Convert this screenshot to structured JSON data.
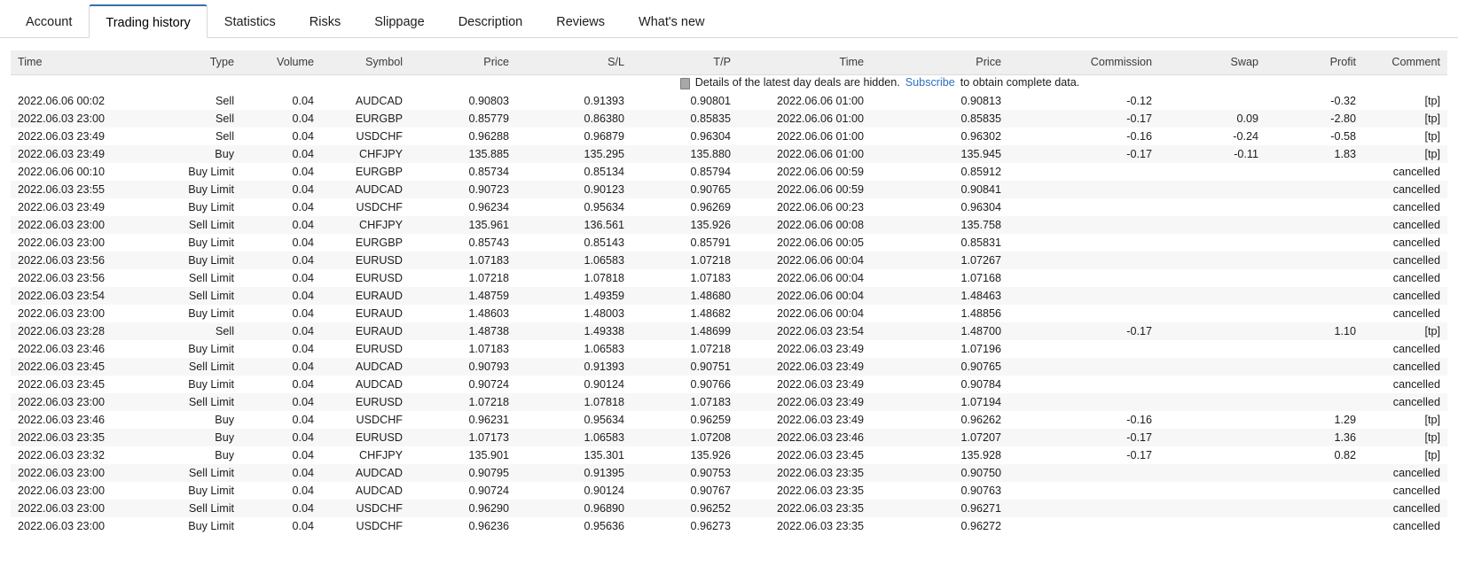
{
  "tabs": [
    {
      "label": "Account",
      "active": false
    },
    {
      "label": "Trading history",
      "active": true
    },
    {
      "label": "Statistics",
      "active": false
    },
    {
      "label": "Risks",
      "active": false
    },
    {
      "label": "Slippage",
      "active": false
    },
    {
      "label": "Description",
      "active": false
    },
    {
      "label": "Reviews",
      "active": false
    },
    {
      "label": "What's new",
      "active": false
    }
  ],
  "table": {
    "headers": [
      {
        "label": "Time",
        "align": "left"
      },
      {
        "label": "Type",
        "align": "right"
      },
      {
        "label": "Volume",
        "align": "right"
      },
      {
        "label": "Symbol",
        "align": "right"
      },
      {
        "label": "Price",
        "align": "right"
      },
      {
        "label": "S/L",
        "align": "right"
      },
      {
        "label": "T/P",
        "align": "right"
      },
      {
        "label": "Time",
        "align": "right"
      },
      {
        "label": "Price",
        "align": "right"
      },
      {
        "label": "Commission",
        "align": "right"
      },
      {
        "label": "Swap",
        "align": "right"
      },
      {
        "label": "Profit",
        "align": "right"
      },
      {
        "label": "Comment",
        "align": "right"
      }
    ],
    "notice": {
      "icon": "info-icon",
      "text_before": "Details of the latest day deals are hidden.",
      "link_label": "Subscribe",
      "text_after": "to obtain complete data."
    },
    "rows": [
      {
        "time_open": "2022.06.06 00:02",
        "type": "Sell",
        "volume": "0.04",
        "symbol": "AUDCAD",
        "price_open": "0.90803",
        "sl": "0.91393",
        "tp": "0.90801",
        "time_close": "2022.06.06 01:00",
        "price_close": "0.90813",
        "commission": "-0.12",
        "swap": "",
        "profit": "-0.32",
        "comment": "[tp]"
      },
      {
        "time_open": "2022.06.03 23:00",
        "type": "Sell",
        "volume": "0.04",
        "symbol": "EURGBP",
        "price_open": "0.85779",
        "sl": "0.86380",
        "tp": "0.85835",
        "time_close": "2022.06.06 01:00",
        "price_close": "0.85835",
        "commission": "-0.17",
        "swap": "0.09",
        "profit": "-2.80",
        "comment": "[tp]"
      },
      {
        "time_open": "2022.06.03 23:49",
        "type": "Sell",
        "volume": "0.04",
        "symbol": "USDCHF",
        "price_open": "0.96288",
        "sl": "0.96879",
        "tp": "0.96304",
        "time_close": "2022.06.06 01:00",
        "price_close": "0.96302",
        "commission": "-0.16",
        "swap": "-0.24",
        "profit": "-0.58",
        "comment": "[tp]"
      },
      {
        "time_open": "2022.06.03 23:49",
        "type": "Buy",
        "volume": "0.04",
        "symbol": "CHFJPY",
        "price_open": "135.885",
        "sl": "135.295",
        "tp": "135.880",
        "time_close": "2022.06.06 01:00",
        "price_close": "135.945",
        "commission": "-0.17",
        "swap": "-0.11",
        "profit": "1.83",
        "comment": "[tp]"
      },
      {
        "time_open": "2022.06.06 00:10",
        "type": "Buy Limit",
        "volume": "0.04",
        "symbol": "EURGBP",
        "price_open": "0.85734",
        "sl": "0.85134",
        "tp": "0.85794",
        "time_close": "2022.06.06 00:59",
        "price_close": "0.85912",
        "commission": "",
        "swap": "",
        "profit": "",
        "comment": "cancelled"
      },
      {
        "time_open": "2022.06.03 23:55",
        "type": "Buy Limit",
        "volume": "0.04",
        "symbol": "AUDCAD",
        "price_open": "0.90723",
        "sl": "0.90123",
        "tp": "0.90765",
        "time_close": "2022.06.06 00:59",
        "price_close": "0.90841",
        "commission": "",
        "swap": "",
        "profit": "",
        "comment": "cancelled"
      },
      {
        "time_open": "2022.06.03 23:49",
        "type": "Buy Limit",
        "volume": "0.04",
        "symbol": "USDCHF",
        "price_open": "0.96234",
        "sl": "0.95634",
        "tp": "0.96269",
        "time_close": "2022.06.06 00:23",
        "price_close": "0.96304",
        "commission": "",
        "swap": "",
        "profit": "",
        "comment": "cancelled"
      },
      {
        "time_open": "2022.06.03 23:00",
        "type": "Sell Limit",
        "volume": "0.04",
        "symbol": "CHFJPY",
        "price_open": "135.961",
        "sl": "136.561",
        "tp": "135.926",
        "time_close": "2022.06.06 00:08",
        "price_close": "135.758",
        "commission": "",
        "swap": "",
        "profit": "",
        "comment": "cancelled",
        "caret": true
      },
      {
        "time_open": "2022.06.03 23:00",
        "type": "Buy Limit",
        "volume": "0.04",
        "symbol": "EURGBP",
        "price_open": "0.85743",
        "sl": "0.85143",
        "tp": "0.85791",
        "time_close": "2022.06.06 00:05",
        "price_close": "0.85831",
        "commission": "",
        "swap": "",
        "profit": "",
        "comment": "cancelled"
      },
      {
        "time_open": "2022.06.03 23:56",
        "type": "Buy Limit",
        "volume": "0.04",
        "symbol": "EURUSD",
        "price_open": "1.07183",
        "sl": "1.06583",
        "tp": "1.07218",
        "time_close": "2022.06.06 00:04",
        "price_close": "1.07267",
        "commission": "",
        "swap": "",
        "profit": "",
        "comment": "cancelled"
      },
      {
        "time_open": "2022.06.03 23:56",
        "type": "Sell Limit",
        "volume": "0.04",
        "symbol": "EURUSD",
        "price_open": "1.07218",
        "sl": "1.07818",
        "tp": "1.07183",
        "time_close": "2022.06.06 00:04",
        "price_close": "1.07168",
        "commission": "",
        "swap": "",
        "profit": "",
        "comment": "cancelled"
      },
      {
        "time_open": "2022.06.03 23:54",
        "type": "Sell Limit",
        "volume": "0.04",
        "symbol": "EURAUD",
        "price_open": "1.48759",
        "sl": "1.49359",
        "tp": "1.48680",
        "time_close": "2022.06.06 00:04",
        "price_close": "1.48463",
        "commission": "",
        "swap": "",
        "profit": "",
        "comment": "cancelled"
      },
      {
        "time_open": "2022.06.03 23:00",
        "type": "Buy Limit",
        "volume": "0.04",
        "symbol": "EURAUD",
        "price_open": "1.48603",
        "sl": "1.48003",
        "tp": "1.48682",
        "time_close": "2022.06.06 00:04",
        "price_close": "1.48856",
        "commission": "",
        "swap": "",
        "profit": "",
        "comment": "cancelled"
      },
      {
        "time_open": "2022.06.03 23:28",
        "type": "Sell",
        "volume": "0.04",
        "symbol": "EURAUD",
        "price_open": "1.48738",
        "sl": "1.49338",
        "tp": "1.48699",
        "time_close": "2022.06.03 23:54",
        "price_close": "1.48700",
        "commission": "-0.17",
        "swap": "",
        "profit": "1.10",
        "comment": "[tp]"
      },
      {
        "time_open": "2022.06.03 23:46",
        "type": "Buy Limit",
        "volume": "0.04",
        "symbol": "EURUSD",
        "price_open": "1.07183",
        "sl": "1.06583",
        "tp": "1.07218",
        "time_close": "2022.06.03 23:49",
        "price_close": "1.07196",
        "commission": "",
        "swap": "",
        "profit": "",
        "comment": "cancelled"
      },
      {
        "time_open": "2022.06.03 23:45",
        "type": "Sell Limit",
        "volume": "0.04",
        "symbol": "AUDCAD",
        "price_open": "0.90793",
        "sl": "0.91393",
        "tp": "0.90751",
        "time_close": "2022.06.03 23:49",
        "price_close": "0.90765",
        "commission": "",
        "swap": "",
        "profit": "",
        "comment": "cancelled"
      },
      {
        "time_open": "2022.06.03 23:45",
        "type": "Buy Limit",
        "volume": "0.04",
        "symbol": "AUDCAD",
        "price_open": "0.90724",
        "sl": "0.90124",
        "tp": "0.90766",
        "time_close": "2022.06.03 23:49",
        "price_close": "0.90784",
        "commission": "",
        "swap": "",
        "profit": "",
        "comment": "cancelled"
      },
      {
        "time_open": "2022.06.03 23:00",
        "type": "Sell Limit",
        "volume": "0.04",
        "symbol": "EURUSD",
        "price_open": "1.07218",
        "sl": "1.07818",
        "tp": "1.07183",
        "time_close": "2022.06.03 23:49",
        "price_close": "1.07194",
        "commission": "",
        "swap": "",
        "profit": "",
        "comment": "cancelled"
      },
      {
        "time_open": "2022.06.03 23:46",
        "type": "Buy",
        "volume": "0.04",
        "symbol": "USDCHF",
        "price_open": "0.96231",
        "sl": "0.95634",
        "tp": "0.96259",
        "time_close": "2022.06.03 23:49",
        "price_close": "0.96262",
        "commission": "-0.16",
        "swap": "",
        "profit": "1.29",
        "comment": "[tp]"
      },
      {
        "time_open": "2022.06.03 23:35",
        "type": "Buy",
        "volume": "0.04",
        "symbol": "EURUSD",
        "price_open": "1.07173",
        "sl": "1.06583",
        "tp": "1.07208",
        "time_close": "2022.06.03 23:46",
        "price_close": "1.07207",
        "commission": "-0.17",
        "swap": "",
        "profit": "1.36",
        "comment": "[tp]"
      },
      {
        "time_open": "2022.06.03 23:32",
        "type": "Buy",
        "volume": "0.04",
        "symbol": "CHFJPY",
        "price_open": "135.901",
        "sl": "135.301",
        "tp": "135.926",
        "time_close": "2022.06.03 23:45",
        "price_close": "135.928",
        "commission": "-0.17",
        "swap": "",
        "profit": "0.82",
        "comment": "[tp]"
      },
      {
        "time_open": "2022.06.03 23:00",
        "type": "Sell Limit",
        "volume": "0.04",
        "symbol": "AUDCAD",
        "price_open": "0.90795",
        "sl": "0.91395",
        "tp": "0.90753",
        "time_close": "2022.06.03 23:35",
        "price_close": "0.90750",
        "commission": "",
        "swap": "",
        "profit": "",
        "comment": "cancelled"
      },
      {
        "time_open": "2022.06.03 23:00",
        "type": "Buy Limit",
        "volume": "0.04",
        "symbol": "AUDCAD",
        "price_open": "0.90724",
        "sl": "0.90124",
        "tp": "0.90767",
        "time_close": "2022.06.03 23:35",
        "price_close": "0.90763",
        "commission": "",
        "swap": "",
        "profit": "",
        "comment": "cancelled"
      },
      {
        "time_open": "2022.06.03 23:00",
        "type": "Sell Limit",
        "volume": "0.04",
        "symbol": "USDCHF",
        "price_open": "0.96290",
        "sl": "0.96890",
        "tp": "0.96252",
        "time_close": "2022.06.03 23:35",
        "price_close": "0.96271",
        "commission": "",
        "swap": "",
        "profit": "",
        "comment": "cancelled"
      },
      {
        "time_open": "2022.06.03 23:00",
        "type": "Buy Limit",
        "volume": "0.04",
        "symbol": "USDCHF",
        "price_open": "0.96236",
        "sl": "0.95636",
        "tp": "0.96273",
        "time_close": "2022.06.03 23:35",
        "price_close": "0.96272",
        "commission": "",
        "swap": "",
        "profit": "",
        "comment": "cancelled"
      }
    ]
  },
  "colors": {
    "negative": "#cf2020",
    "positive": "#2b6cb8",
    "link": "#2d6fbf",
    "tab_accent": "#3a6ea5",
    "header_bg": "#efefef",
    "alt_row_bg": "#f7f7f7"
  }
}
